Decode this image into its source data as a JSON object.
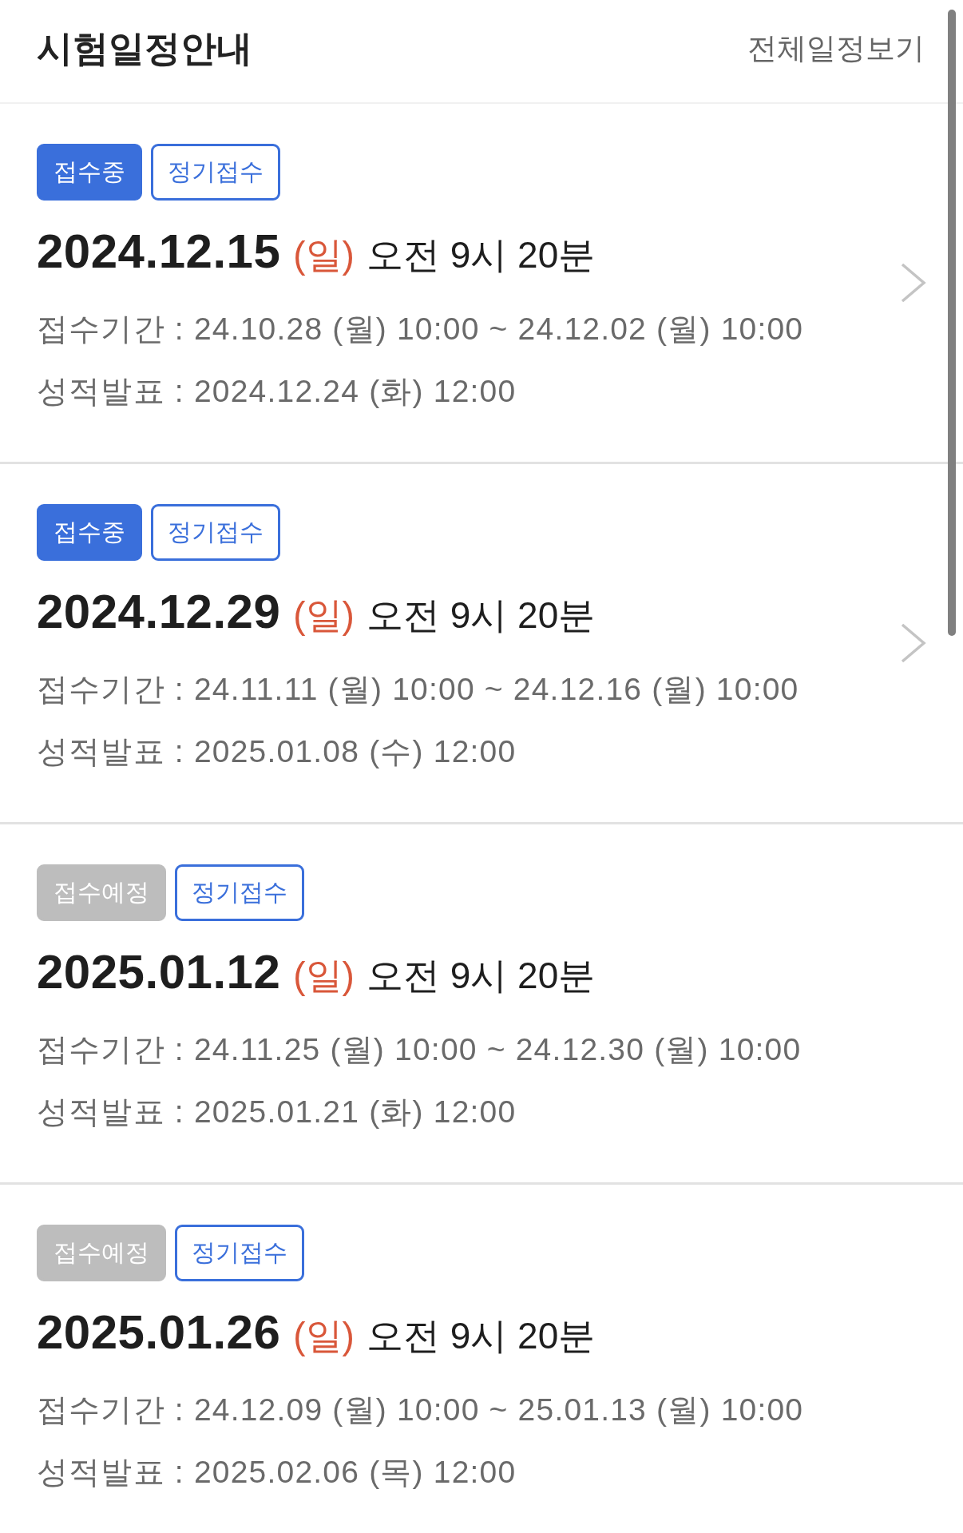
{
  "header": {
    "title": "시험일정안내",
    "link": "전체일정보기"
  },
  "exams": [
    {
      "tags": [
        {
          "label": "접수중",
          "kind": "open"
        },
        {
          "label": "정기접수",
          "kind": "type"
        }
      ],
      "date": "2024.12.15",
      "weekday": "(일)",
      "time": "오전 9시 20분",
      "details": [
        "접수기간 : 24.10.28 (월) 10:00 ~ 24.12.02 (월) 10:00",
        "성적발표 : 2024.12.24 (화) 12:00"
      ],
      "linked": true
    },
    {
      "tags": [
        {
          "label": "접수중",
          "kind": "open"
        },
        {
          "label": "정기접수",
          "kind": "type"
        }
      ],
      "date": "2024.12.29",
      "weekday": "(일)",
      "time": "오전 9시 20분",
      "details": [
        "접수기간 : 24.11.11 (월) 10:00 ~ 24.12.16 (월) 10:00",
        "성적발표 : 2025.01.08 (수) 12:00"
      ],
      "linked": true
    },
    {
      "tags": [
        {
          "label": "접수예정",
          "kind": "upcoming"
        },
        {
          "label": "정기접수",
          "kind": "type"
        }
      ],
      "date": "2025.01.12",
      "weekday": "(일)",
      "time": "오전 9시 20분",
      "details": [
        "접수기간 : 24.11.25 (월) 10:00 ~ 24.12.30 (월) 10:00",
        "성적발표 : 2025.01.21 (화) 12:00"
      ],
      "linked": false
    },
    {
      "tags": [
        {
          "label": "접수예정",
          "kind": "upcoming"
        },
        {
          "label": "정기접수",
          "kind": "type"
        }
      ],
      "date": "2025.01.26",
      "weekday": "(일)",
      "time": "오전 9시 20분",
      "details": [
        "접수기간 : 24.12.09 (월) 10:00 ~ 25.01.13 (월) 10:00",
        "성적발표 : 2025.02.06 (목) 12:00"
      ],
      "linked": false
    }
  ]
}
